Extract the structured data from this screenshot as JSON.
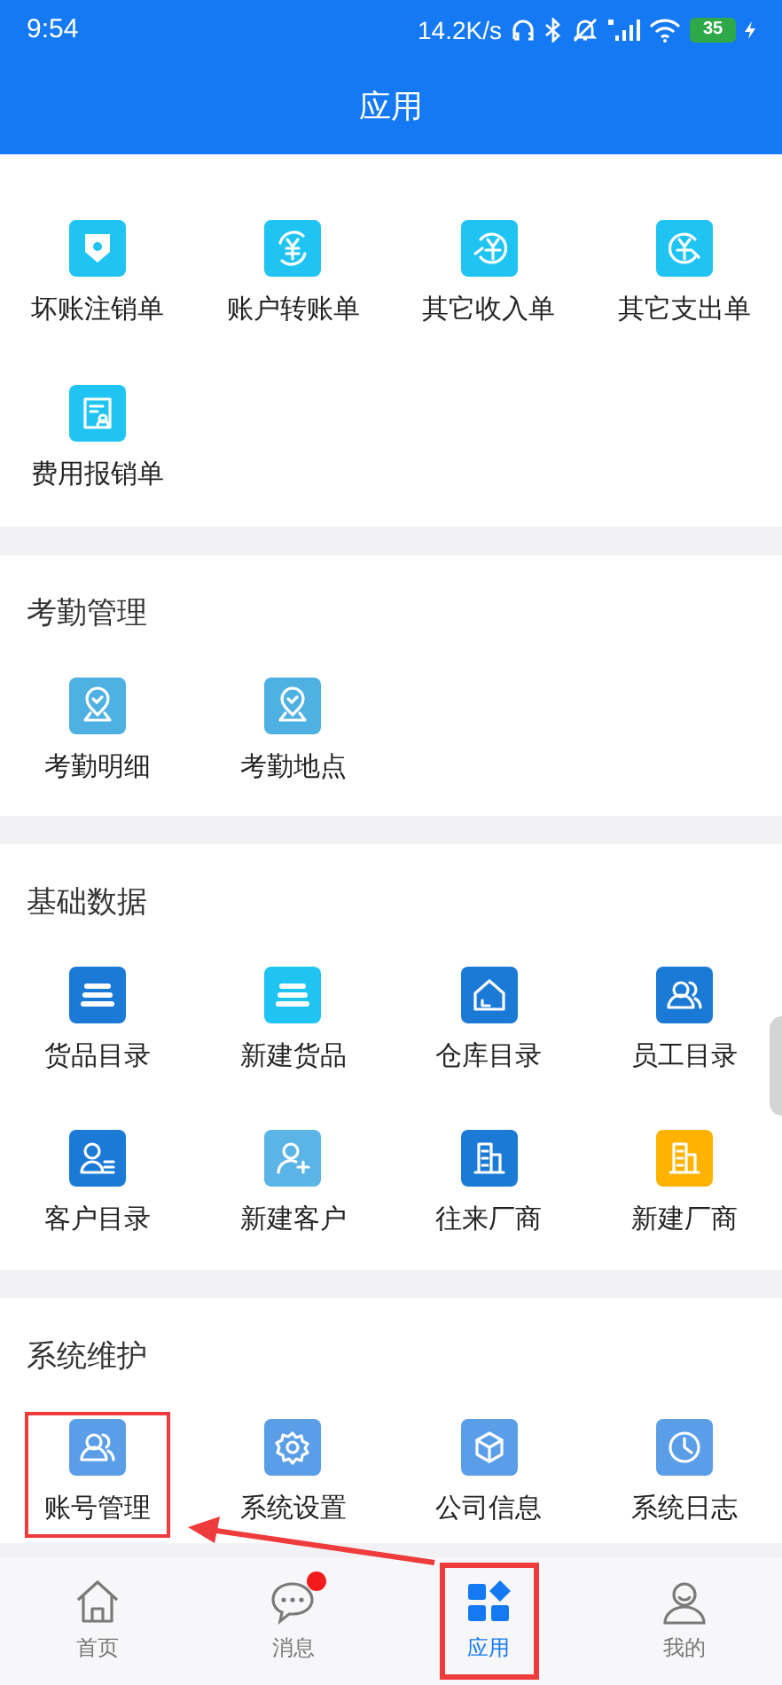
{
  "status_bar": {
    "time": "9:54",
    "speed": "14.2K/s",
    "battery": "35"
  },
  "header": {
    "title": "应用"
  },
  "sections": [
    {
      "items": [
        {
          "label": "坏账注销单",
          "kind": "shield",
          "color": "#20c4f2",
          "highlighted": false
        },
        {
          "label": "账户转账单",
          "kind": "yen-cycle",
          "color": "#20c4f2",
          "highlighted": false
        },
        {
          "label": "其它收入单",
          "kind": "yen-in",
          "color": "#20c4f2",
          "highlighted": false
        },
        {
          "label": "其它支出单",
          "kind": "yen-out",
          "color": "#20c4f2",
          "highlighted": false
        },
        {
          "label": "费用报销单",
          "kind": "receipt",
          "color": "#20c4f2",
          "highlighted": false
        }
      ]
    },
    {
      "title": "考勤管理",
      "items": [
        {
          "label": "考勤明细",
          "kind": "location",
          "color": "#4fb0e2",
          "highlighted": false
        },
        {
          "label": "考勤地点",
          "kind": "location",
          "color": "#4fb0e2",
          "highlighted": false
        }
      ]
    },
    {
      "title": "基础数据",
      "items": [
        {
          "label": "货品目录",
          "kind": "stack",
          "color": "#1a7ad6",
          "highlighted": false
        },
        {
          "label": "新建货品",
          "kind": "stack",
          "color": "#20c4f2",
          "highlighted": false
        },
        {
          "label": "仓库目录",
          "kind": "house",
          "color": "#1a7ad6",
          "highlighted": false
        },
        {
          "label": "员工目录",
          "kind": "people",
          "color": "#1a7ad6",
          "highlighted": false
        },
        {
          "label": "客户目录",
          "kind": "person-list",
          "color": "#1a7ad6",
          "highlighted": false
        },
        {
          "label": "新建客户",
          "kind": "person-add",
          "color": "#5ab4e6",
          "highlighted": false
        },
        {
          "label": "往来厂商",
          "kind": "building",
          "color": "#1a7ad6",
          "highlighted": false
        },
        {
          "label": "新建厂商",
          "kind": "building",
          "color": "#ffb300",
          "highlighted": false
        }
      ]
    },
    {
      "title": "系统维护",
      "items": [
        {
          "label": "账号管理",
          "kind": "people",
          "color": "#5b9ee8",
          "highlighted": true
        },
        {
          "label": "系统设置",
          "kind": "gear",
          "color": "#5b9ee8",
          "highlighted": false
        },
        {
          "label": "公司信息",
          "kind": "cube",
          "color": "#5b9ee8",
          "highlighted": false
        },
        {
          "label": "系统日志",
          "kind": "clock",
          "color": "#5b9ee8",
          "highlighted": false
        }
      ]
    }
  ],
  "tab_bar": [
    {
      "label": "首页",
      "kind": "home",
      "selected": false,
      "badge": false,
      "highlighted": false
    },
    {
      "label": "消息",
      "kind": "chat",
      "selected": false,
      "badge": true,
      "highlighted": false
    },
    {
      "label": "应用",
      "kind": "apps",
      "selected": true,
      "badge": false,
      "highlighted": true
    },
    {
      "label": "我的",
      "kind": "user",
      "selected": false,
      "badge": false,
      "highlighted": false
    }
  ]
}
